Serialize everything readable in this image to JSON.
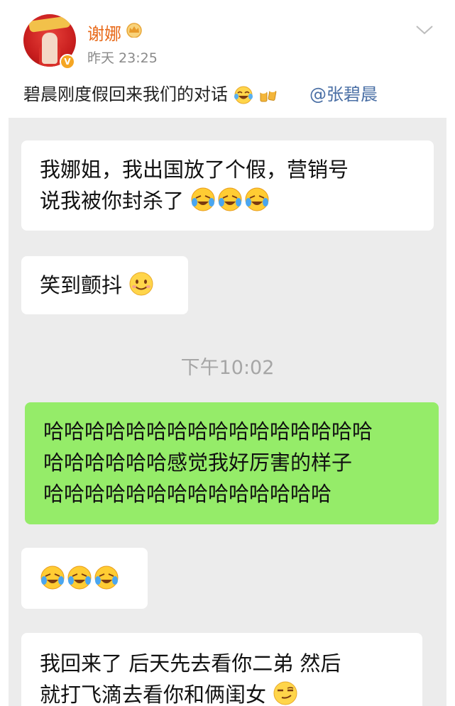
{
  "post": {
    "username": "谢娜",
    "time": "昨天 23:25",
    "verified_label": "V",
    "text": "碧晨刚度假回来我们的对话",
    "mention": "@张碧晨"
  },
  "chat": {
    "messages": [
      {
        "side": "left",
        "lines": [
          "我娜姐，我出国放了个假，营销号",
          "说我被你封杀了"
        ],
        "emoji": [
          "cry-laugh-icon",
          "cry-laugh-icon",
          "cry-laugh-icon"
        ]
      },
      {
        "side": "left",
        "lines": [
          "笑到颤抖"
        ],
        "emoji": [
          "smile-icon"
        ]
      },
      {
        "side": "right",
        "lines": [
          "哈哈哈哈哈哈哈哈哈哈哈哈哈哈哈哈",
          "哈哈哈哈哈哈感觉我好厉害的样子",
          "哈哈哈哈哈哈哈哈哈哈哈哈哈哈"
        ]
      },
      {
        "side": "left",
        "lines": [],
        "emoji": [
          "cry-laugh-icon",
          "cry-laugh-icon",
          "cry-laugh-icon"
        ]
      },
      {
        "side": "left",
        "lines": [
          "我回来了 后天先去看你二弟 然后",
          "就打飞滴去看你和俩闺女"
        ],
        "emoji": [
          "smirk-icon"
        ]
      }
    ],
    "timestamp": "下午10:02"
  },
  "colors": {
    "username": "#e86a1a",
    "mention": "#4a6fa5",
    "chat_bg": "#ececec",
    "bubble_green": "#95ec69",
    "bubble_white": "#ffffff"
  }
}
